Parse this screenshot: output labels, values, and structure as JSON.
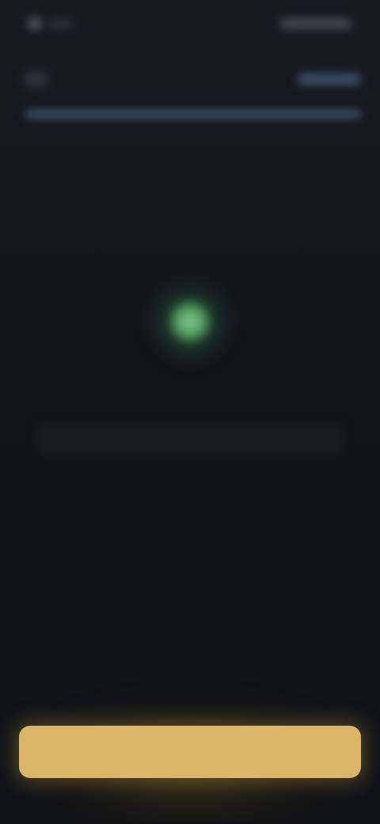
{
  "screen": {
    "title": "",
    "subtitle": "",
    "info_text": ""
  },
  "cta": {
    "label": ""
  },
  "progress": {
    "fraction": 1.0
  },
  "colors": {
    "background": "#12151b",
    "accent_button": "#d9b66a",
    "scan_indicator": "#3f8a4f",
    "progress_track": "#3b4758"
  },
  "icons": {
    "back": "back-arrow-icon",
    "scan": "scan-indicator-icon"
  }
}
